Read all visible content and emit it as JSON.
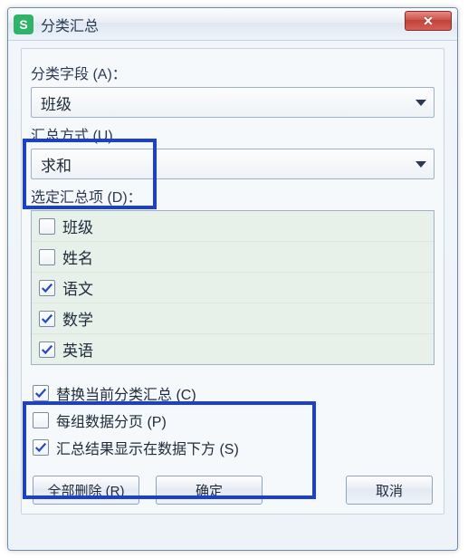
{
  "window": {
    "title": "分类汇总",
    "app_icon_letter": "S",
    "close_glyph": "✕"
  },
  "fields": {
    "category_label": "分类字段 (A)：",
    "category_value": "班级",
    "method_label": "汇总方式 (U)",
    "method_value": "求和",
    "items_label": "选定汇总项 (D)："
  },
  "items": [
    {
      "label": "班级",
      "checked": false
    },
    {
      "label": "姓名",
      "checked": false
    },
    {
      "label": "语文",
      "checked": true
    },
    {
      "label": "数学",
      "checked": true
    },
    {
      "label": "英语",
      "checked": true
    }
  ],
  "options": [
    {
      "label": "替换当前分类汇总 (C)",
      "checked": true
    },
    {
      "label": "每组数据分页 (P)",
      "checked": false
    },
    {
      "label": "汇总结果显示在数据下方 (S)",
      "checked": true
    }
  ],
  "buttons": {
    "delete_all": "全部删除 (R)",
    "ok": "确定",
    "cancel": "取消"
  }
}
